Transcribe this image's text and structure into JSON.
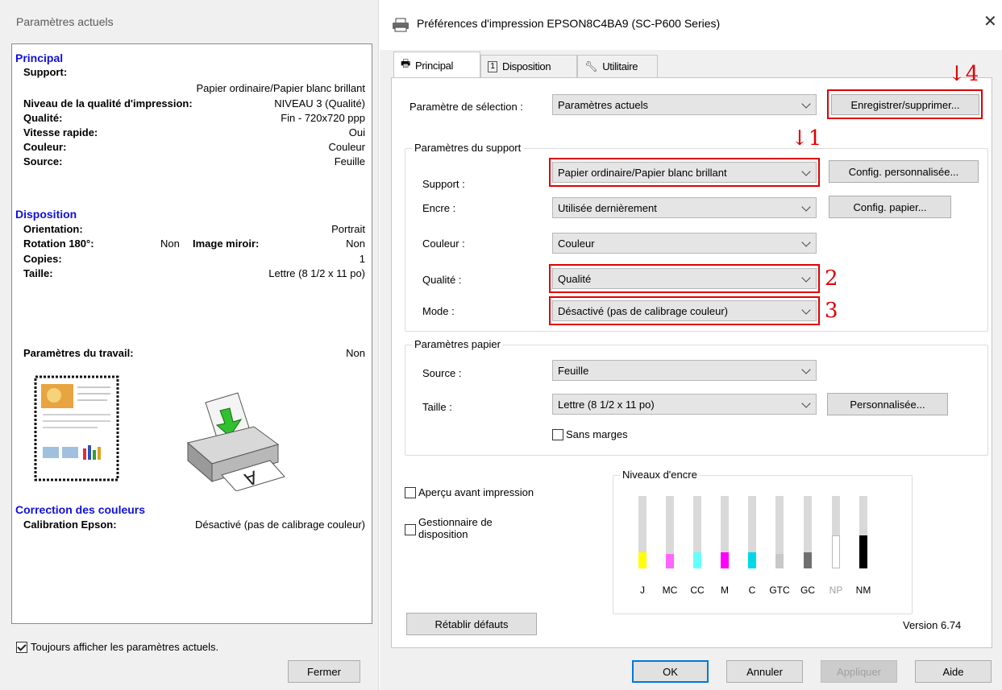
{
  "current_settings": {
    "title": "Paramètres actuels",
    "principal": {
      "heading": "Principal",
      "support_label": "Support:",
      "support_value": "Papier ordinaire/Papier blanc brillant",
      "quality_level_label": "Niveau de la qualité d'impression:",
      "quality_level_value": "NIVEAU 3 (Qualité)",
      "quality_label": "Qualité:",
      "quality_value": "Fin - 720x720 ppp",
      "fast_label": "Vitesse rapide:",
      "fast_value": "Oui",
      "color_label": "Couleur:",
      "color_value": "Couleur",
      "source_label": "Source:",
      "source_value": "Feuille"
    },
    "layout": {
      "heading": "Disposition",
      "orientation_label": "Orientation:",
      "orientation_value": "Portrait",
      "rotation_label": "Rotation 180°:",
      "rotation_value": "Non",
      "mirror_label": "Image miroir:",
      "mirror_value": "Non",
      "copies_label": "Copies:",
      "copies_value": "1",
      "size_label": "Taille:",
      "size_value": "Lettre (8 1/2 x 11 po)"
    },
    "job_label": "Paramètres du travail:",
    "job_value": "Non",
    "color_correction": {
      "heading": "Correction des couleurs",
      "calibration_label": "Calibration Epson:",
      "calibration_value": "Désactivé (pas de calibrage couleur)"
    },
    "always_show": "Toujours afficher les paramètres actuels.",
    "close_btn": "Fermer"
  },
  "dialog": {
    "title": "Préférences d'impression EPSON8C4BA9 (SC-P600 Series)",
    "tabs": [
      "Principal",
      "Disposition",
      "Utilitaire"
    ],
    "selection_label": "Paramètre de sélection :",
    "selection_value": "Paramètres actuels",
    "save_btn": "Enregistrer/supprimer...",
    "media_group": "Paramètres du support",
    "support_label": "Support :",
    "support_value": "Papier ordinaire/Papier blanc brillant",
    "custom_config_btn": "Config. personnalisée...",
    "ink_label": "Encre :",
    "ink_value": "Utilisée dernièrement",
    "paper_config_btn": "Config. papier...",
    "color_label": "Couleur :",
    "color_value": "Couleur",
    "quality_label": "Qualité :",
    "quality_value": "Qualité",
    "mode_label": "Mode :",
    "mode_value": "Désactivé (pas de calibrage couleur)",
    "paper_group": "Paramètres papier",
    "source_label": "Source :",
    "source_value": "Feuille",
    "size_label": "Taille :",
    "size_value": "Lettre (8 1/2 x 11 po)",
    "custom_btn": "Personnalisée...",
    "borderless": "Sans marges",
    "preview": "Aperçu avant impression",
    "layout_manager": "Gestionnaire de disposition",
    "ink_levels_title": "Niveaux d'encre",
    "inks": [
      {
        "label": "J",
        "level": 0.22,
        "color": "#ffff00"
      },
      {
        "label": "MC",
        "level": 0.2,
        "color": "#ff66ff"
      },
      {
        "label": "CC",
        "level": 0.22,
        "color": "#66ffff"
      },
      {
        "label": "M",
        "level": 0.22,
        "color": "#ff00ff"
      },
      {
        "label": "C",
        "level": 0.22,
        "color": "#00d8e8"
      },
      {
        "label": "GTC",
        "level": 0.2,
        "color": "#c8c8c8"
      },
      {
        "label": "GC",
        "level": 0.22,
        "color": "#707070"
      },
      {
        "label": "NP",
        "level": 0.45,
        "color": "#ffffff"
      },
      {
        "label": "NM",
        "level": 0.45,
        "color": "#000000"
      }
    ],
    "restore_btn": "Rétablir défauts",
    "version": "Version 6.74",
    "ok": "OK",
    "cancel": "Annuler",
    "apply": "Appliquer",
    "help": "Aide",
    "annotations": [
      "↓4",
      "↓1",
      "2",
      "3"
    ]
  }
}
